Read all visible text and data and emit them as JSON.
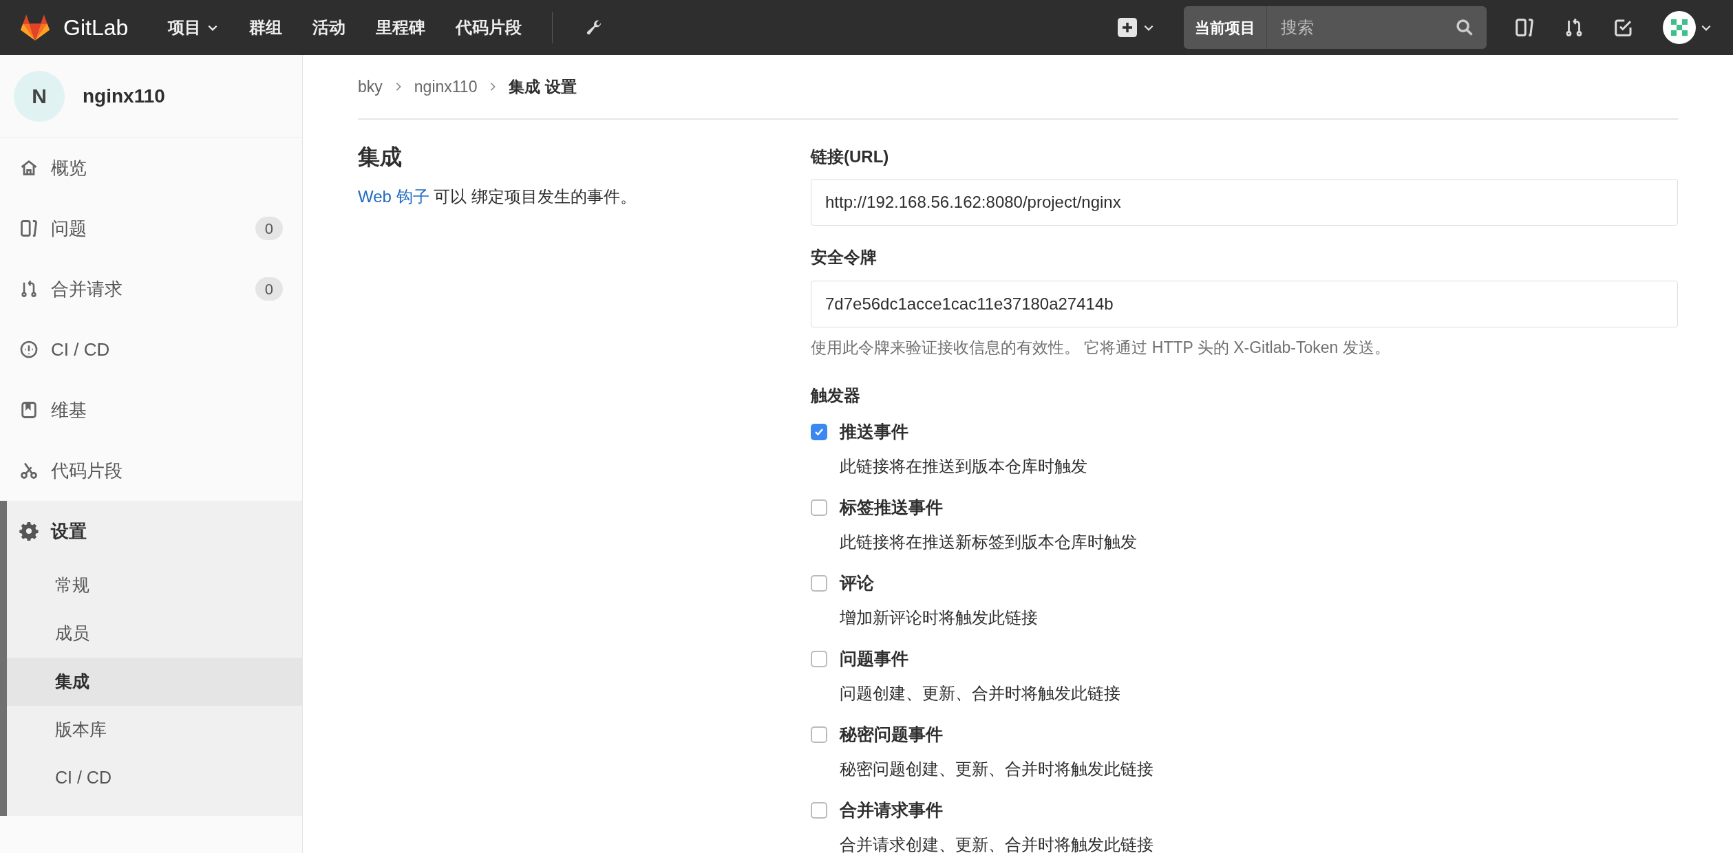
{
  "navbar": {
    "brand": "GitLab",
    "menu": [
      {
        "label": "项目",
        "dropdown": true
      },
      {
        "label": "群组",
        "dropdown": false
      },
      {
        "label": "活动",
        "dropdown": false
      },
      {
        "label": "里程碑",
        "dropdown": false
      },
      {
        "label": "代码片段",
        "dropdown": false
      }
    ],
    "search": {
      "scope": "当前项目",
      "placeholder": "搜索"
    }
  },
  "sidebar": {
    "project": {
      "initial": "N",
      "name": "nginx110"
    },
    "items": [
      {
        "label": "概览",
        "kind": "home"
      },
      {
        "label": "问题",
        "kind": "issues",
        "badge": "0"
      },
      {
        "label": "合并请求",
        "kind": "merge",
        "badge": "0"
      },
      {
        "label": "CI / CD",
        "kind": "ci"
      },
      {
        "label": "维基",
        "kind": "wiki"
      },
      {
        "label": "代码片段",
        "kind": "snippet"
      }
    ],
    "settings": {
      "label": "设置",
      "expanded": true,
      "children": [
        {
          "label": "常规",
          "selected": false
        },
        {
          "label": "成员",
          "selected": false
        },
        {
          "label": "集成",
          "selected": true
        },
        {
          "label": "版本库",
          "selected": false
        },
        {
          "label": "CI / CD",
          "selected": false
        }
      ]
    }
  },
  "breadcrumb": [
    "bky",
    "nginx110",
    "集成 设置"
  ],
  "intro": {
    "title": "集成",
    "link": "Web 钩子",
    "text": "可以 绑定项目发生的事件。"
  },
  "form": {
    "url": {
      "label": "链接(URL)",
      "value": "http://192.168.56.162:8080/project/nginx"
    },
    "token": {
      "label": "安全令牌",
      "value": "7d7e56dc1acce1cac11e37180a27414b",
      "help": "使用此令牌来验证接收信息的有效性。 它将通过 HTTP 头的 X-Gitlab-Token 发送。"
    },
    "triggers_label": "触发器",
    "triggers": [
      {
        "label": "推送事件",
        "description": "此链接将在推送到版本仓库时触发",
        "checked": true
      },
      {
        "label": "标签推送事件",
        "description": "此链接将在推送新标签到版本仓库时触发",
        "checked": false
      },
      {
        "label": "评论",
        "description": "增加新评论时将触发此链接",
        "checked": false
      },
      {
        "label": "问题事件",
        "description": "问题创建、更新、合并时将触发此链接",
        "checked": false
      },
      {
        "label": "秘密问题事件",
        "description": "秘密问题创建、更新、合并时将触发此链接",
        "checked": false
      },
      {
        "label": "合并请求事件",
        "description": "合并请求创建、更新、合并时将触发此链接",
        "checked": false
      }
    ]
  }
}
